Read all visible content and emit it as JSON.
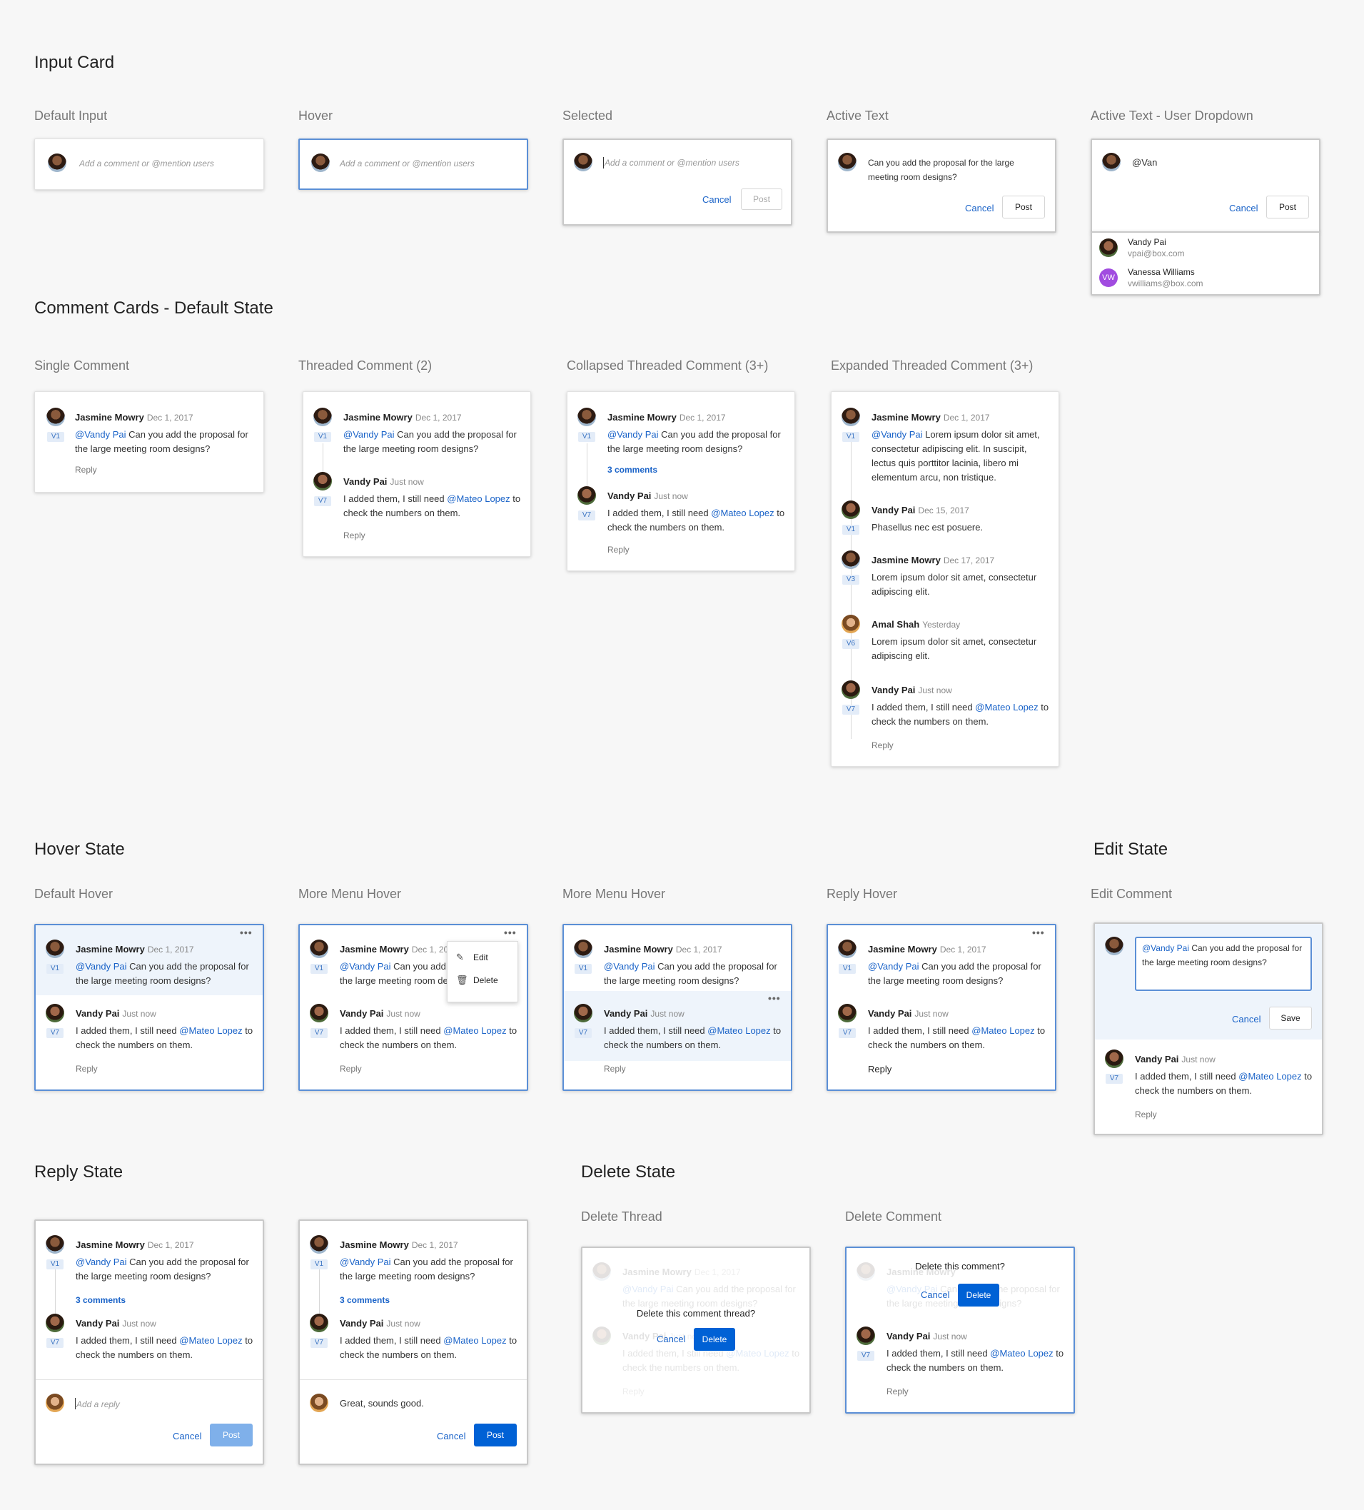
{
  "sections": {
    "input_card": "Input Card",
    "comment_cards": "Comment Cards - Default State",
    "hover_state": "Hover State",
    "edit_state": "Edit State",
    "reply_state": "Reply State",
    "delete_state": "Delete State"
  },
  "labels": {
    "default_input": "Default Input",
    "hover": "Hover",
    "selected": "Selected",
    "active_text": "Active Text",
    "active_dropdown": "Active Text - User Dropdown",
    "single_comment": "Single Comment",
    "threaded_2": "Threaded Comment (2)",
    "collapsed_3": "Collapsed Threaded Comment (3+)",
    "expanded_3": "Expanded Threaded Comment (3+)",
    "default_hover": "Default Hover",
    "more_menu_hover": "More Menu Hover",
    "reply_hover": "Reply Hover",
    "edit_comment": "Edit Comment",
    "delete_thread": "Delete Thread",
    "delete_comment": "Delete Comment"
  },
  "input": {
    "placeholder": "Add a comment or @mention users",
    "active_text": "Can you add the proposal for the large meeting room designs?",
    "mention_text": "@Van",
    "cancel": "Cancel",
    "post": "Post",
    "save": "Save",
    "reply_placeholder": "Add a reply",
    "reply_text": "Great, sounds good."
  },
  "users": [
    {
      "name": "Vandy Pai",
      "email": "vpai@box.com"
    },
    {
      "name": "Vanessa Williams",
      "email": "vwilliams@box.com",
      "initials": "VW"
    }
  ],
  "comment": {
    "jm_name": "Jasmine Mowry",
    "jm_date": "Dec 1, 2017",
    "v1": "V1",
    "mention_vandy": "@Vandy Pai",
    "jm_text": "Can you add the proposal for the large meeting room designs?",
    "vp_name": "Vandy Pai",
    "vp_date": "Just now",
    "v7": "V7",
    "vp_text_a": "I added them, I still need",
    "mention_mateo": "@Mateo Lopez",
    "vp_text_b": "to check the numbers on them.",
    "reply": "Reply",
    "three_comments": "3 comments"
  },
  "expanded": {
    "c1_text": "Lorem ipsum dolor sit amet, consectetur adipiscing elit. In suscipit, lectus quis porttitor lacinia, libero mi elementum arcu, non tristique.",
    "c2_date": "Dec 15, 2017",
    "c2_text": "Phasellus nec est posuere.",
    "c3_date": "Dec 17, 2017",
    "v3": "V3",
    "c3_text": "Lorem ipsum dolor sit amet, consectetur adipiscing elit.",
    "c4_name": "Amal Shah",
    "c4_date": "Yesterday",
    "v6": "V6",
    "c4_text": "Lorem ipsum dolor sit amet, consectetur adipiscing elit."
  },
  "menu": {
    "edit": "Edit",
    "delete": "Delete",
    "dots": "•••"
  },
  "delete": {
    "thread_prompt": "Delete this comment thread?",
    "comment_prompt": "Delete this comment?",
    "cancel": "Cancel",
    "delete": "Delete"
  }
}
